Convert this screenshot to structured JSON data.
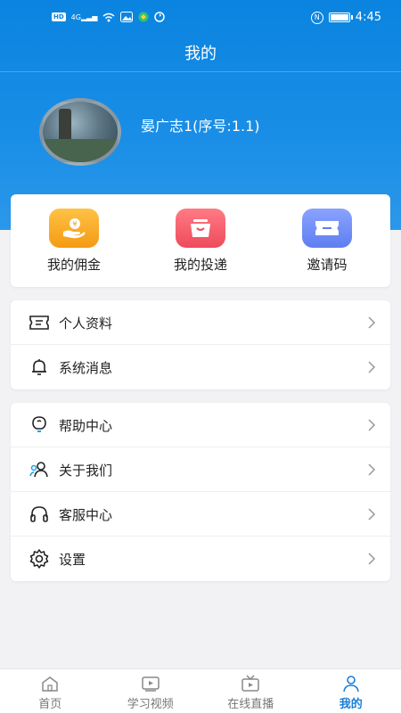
{
  "status": {
    "time": "4:45",
    "hd": "HD",
    "net": "4G",
    "nfc": "N"
  },
  "header": {
    "title": "我的"
  },
  "profile": {
    "name": "晏广志1(序号:1.1)"
  },
  "quick": [
    {
      "label": "我的佣金",
      "icon": "commission-icon",
      "color": "#f7a422"
    },
    {
      "label": "我的投递",
      "icon": "delivery-icon",
      "color": "#f2616d"
    },
    {
      "label": "邀请码",
      "icon": "ticket-icon",
      "color": "#6f8ef5"
    }
  ],
  "menu1": [
    {
      "label": "个人资料",
      "icon": "profile-card-icon"
    },
    {
      "label": "系统消息",
      "icon": "bell-icon"
    }
  ],
  "menu2": [
    {
      "label": "帮助中心",
      "icon": "lightbulb-icon"
    },
    {
      "label": "关于我们",
      "icon": "users-icon"
    },
    {
      "label": "客服中心",
      "icon": "headset-icon"
    },
    {
      "label": "设置",
      "icon": "gear-icon"
    }
  ],
  "tabs": [
    {
      "label": "首页",
      "icon": "home-icon"
    },
    {
      "label": "学习视频",
      "icon": "video-icon"
    },
    {
      "label": "在线直播",
      "icon": "tv-icon"
    },
    {
      "label": "我的",
      "icon": "person-icon",
      "active": true
    }
  ],
  "colors": {
    "primary": "#0a84e0",
    "active_tab": "#1a7fd6"
  }
}
